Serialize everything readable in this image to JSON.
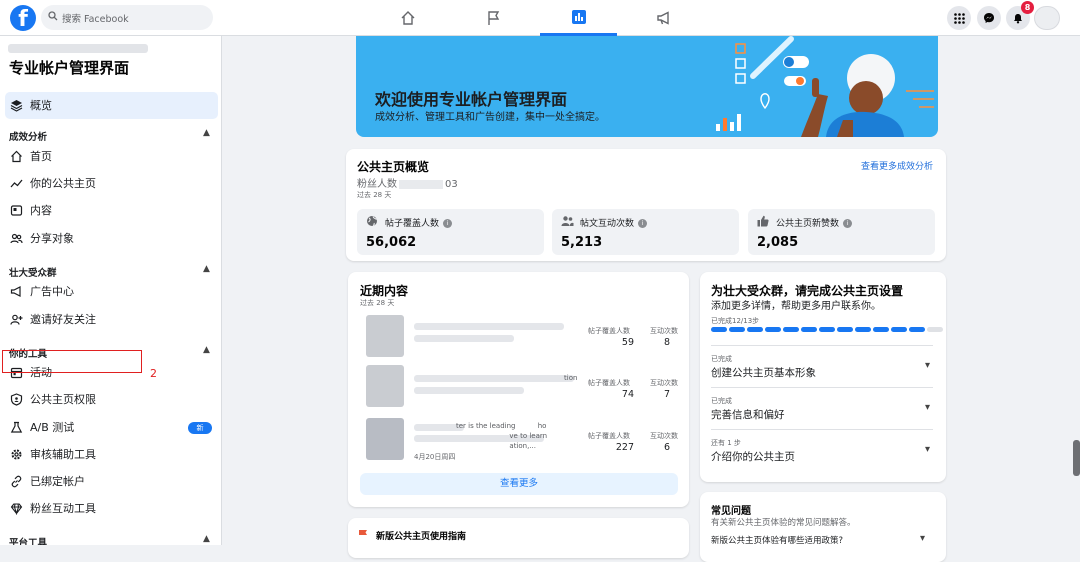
{
  "topbar": {
    "logo_glyph": "f",
    "search_placeholder": "搜索 Facebook",
    "tabs": [
      {
        "icon": "home-icon"
      },
      {
        "icon": "flag-icon"
      },
      {
        "icon": "bar-chart-icon",
        "active": true
      },
      {
        "icon": "megaphone-icon"
      }
    ],
    "right_icons": [
      "menu-grid-icon",
      "messenger-icon",
      "bell-icon"
    ],
    "notification_count": "8"
  },
  "sidebar": {
    "title": "专业帐户管理界面",
    "overview_label": "概览",
    "sections": [
      {
        "heading": "成效分析",
        "items": [
          "首页",
          "你的公共主页",
          "内容",
          "分享对象"
        ]
      },
      {
        "heading": "壮大受众群",
        "items": [
          "广告中心",
          "邀请好友关注"
        ]
      },
      {
        "heading": "你的工具",
        "items": [
          "活动",
          "公共主页权限",
          "A/B 测试",
          "审核辅助工具",
          "已绑定帐户",
          "粉丝互动工具"
        ]
      },
      {
        "heading": "平台工具",
        "items": []
      }
    ],
    "new_badge": "新",
    "annotation_number": "2"
  },
  "banner": {
    "title": "欢迎使用专业帐户管理界面",
    "subtitle": "成效分析、管理工具和广告创建，集中一处全搞定。"
  },
  "overview_card": {
    "title": "公共主页概览",
    "fans_label": "粉丝人数",
    "fans_value_suffix": "03",
    "period": "过去 28 天",
    "more_link": "查看更多成效分析",
    "stats": [
      {
        "label": "帖子覆盖人数",
        "value": "56,062",
        "icon": "globe-icon"
      },
      {
        "label": "帖文互动次数",
        "value": "5,213",
        "icon": "people-icon"
      },
      {
        "label": "公共主页新赞数",
        "value": "2,085",
        "icon": "thumbs-up-icon"
      }
    ]
  },
  "recent_content": {
    "title": "近期内容",
    "period": "过去 28 天",
    "reach_header": "帖子覆盖人数",
    "engage_header": "互动次数",
    "posts": [
      {
        "reach": "59",
        "engagements": "8",
        "snippet": ""
      },
      {
        "reach": "74",
        "engagements": "7",
        "snippet": "tion"
      },
      {
        "reach": "227",
        "engagements": "6",
        "snippet": "ter is the leading          ho\n                        ve to learn\n                        ation,...",
        "date": "4月20日周四"
      }
    ],
    "see_more": "查看更多"
  },
  "guide_card": {
    "title": "新版公共主页使用指南"
  },
  "setup_card": {
    "title": "为壮大受众群，请完成公共主页设置",
    "subtitle": "添加更多详情，帮助更多用户联系你。",
    "progress_label": "已完成12/13步",
    "progress_done": 12,
    "progress_total": 13,
    "steps": [
      {
        "status": "已完成",
        "label": "创建公共主页基本形象"
      },
      {
        "status": "已完成",
        "label": "完善信息和偏好"
      },
      {
        "status": "还有 1 步",
        "label": "介绍你的公共主页"
      }
    ]
  },
  "faq_card": {
    "title": "常见问题",
    "subtitle": "有关新公共主页体验的常见问题解答。",
    "question": "新版公共主页体验有哪些适用政策?"
  },
  "colors": {
    "brand": "#1877f2",
    "banner": "#3ab0f0",
    "highlight": "#e02020"
  }
}
